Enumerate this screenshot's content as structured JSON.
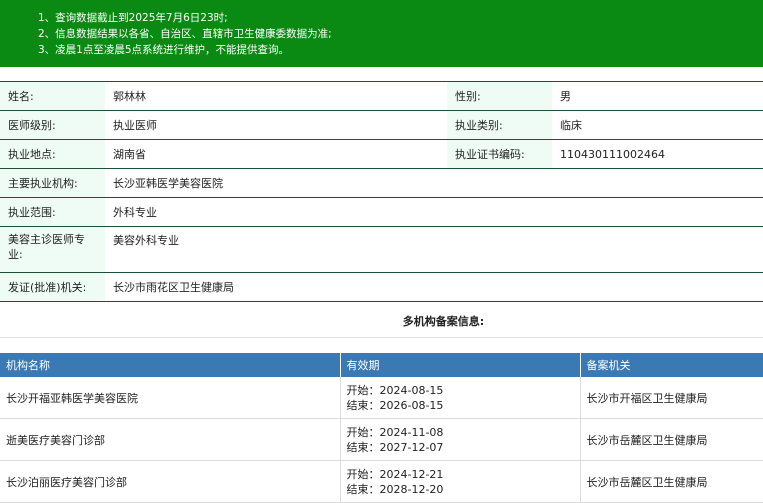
{
  "notice": [
    "1、查询数据截止到2025年7月6日23时;",
    "2、信息数据结果以各省、自治区、直辖市卫生健康委数据为准;",
    "3、凌晨1点至凌晨5点系统进行维护，不能提供查询。"
  ],
  "info": {
    "name_label": "姓名:",
    "name": "郭林林",
    "gender_label": "性别:",
    "gender": "男",
    "level_label": "医师级别:",
    "level": "执业医师",
    "category_label": "执业类别:",
    "category": "临床",
    "location_label": "执业地点:",
    "location": "湖南省",
    "cert_label": "执业证书编码:",
    "cert": "110430111002464",
    "org_label": "主要执业机构:",
    "org": "长沙亚韩医学美容医院",
    "scope_label": "执业范围:",
    "scope": "外科专业",
    "beauty_label": "美容主诊医师专业:",
    "beauty": "美容外科专业",
    "issuer_label": "发证(批准)机关:",
    "issuer": "长沙市雨花区卫生健康局"
  },
  "multi_title": "多机构备案信息:",
  "orgs_table": {
    "headers": [
      "机构名称",
      "有效期",
      "备案机关"
    ],
    "rows": [
      {
        "name": "长沙开福亚韩医学美容医院",
        "start": "开始：2024-08-15",
        "end": "结束：2026-08-15",
        "authority": "长沙市开福区卫生健康局"
      },
      {
        "name": "逝美医疗美容门诊部",
        "start": "开始：2024-11-08",
        "end": "结束：2027-12-07",
        "authority": "长沙市岳麓区卫生健康局"
      },
      {
        "name": "长沙泊丽医疗美容门诊部",
        "start": "开始：2024-12-21",
        "end": "结束：2028-12-20",
        "authority": "长沙市岳麓区卫生健康局"
      }
    ]
  }
}
